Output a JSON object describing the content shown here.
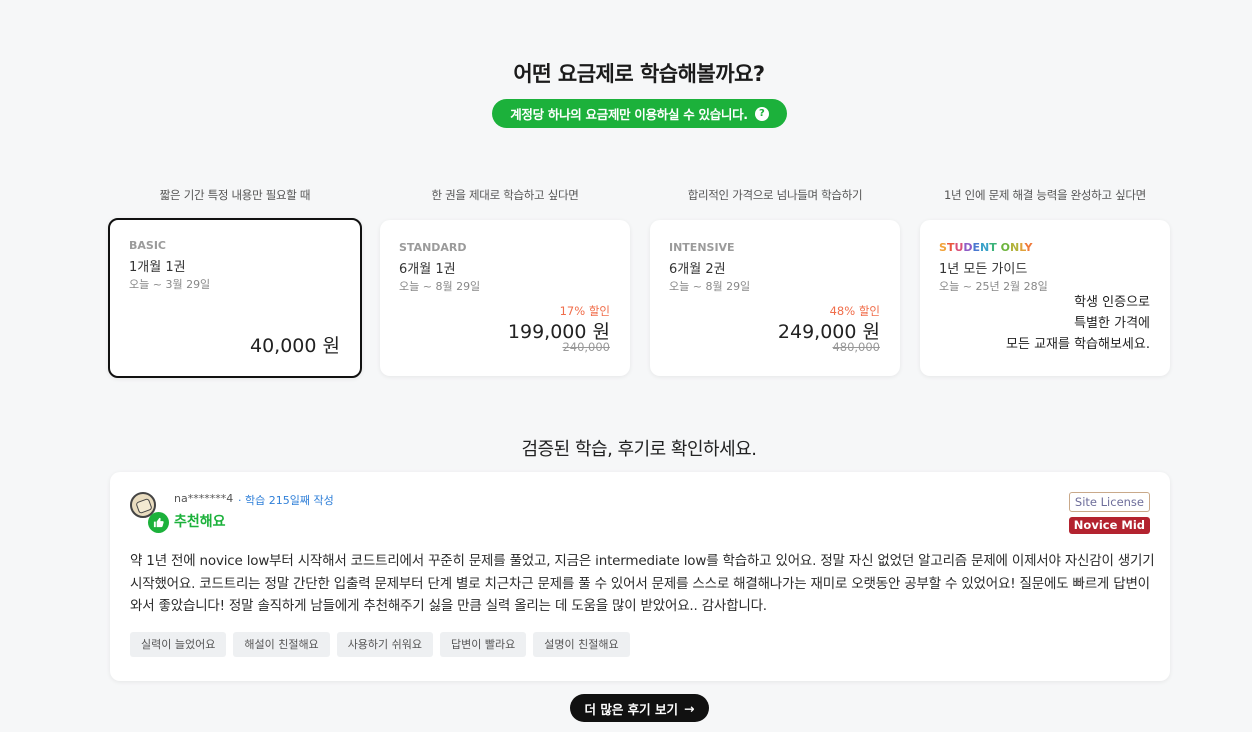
{
  "header": {
    "title": "어떤 요금제로 학습해볼까요?",
    "notice": "계정당 하나의 요금제만 이용하실 수 있습니다.",
    "notice_icon": "question-icon"
  },
  "plans": [
    {
      "caption": "짧은 기간 특정 내용만 필요할 때",
      "name": "BASIC",
      "period": "1개월 1권",
      "range": "오늘 ~ 3월 29일",
      "discount": "",
      "price": "40,000 원",
      "original_price": "",
      "selected": true
    },
    {
      "caption": "한 권을 제대로 학습하고 싶다면",
      "name": "STANDARD",
      "period": "6개월 1권",
      "range": "오늘 ~ 8월 29일",
      "discount": "17% 할인",
      "price": "199,000 원",
      "original_price": "240,000",
      "selected": false
    },
    {
      "caption": "합리적인 가격으로 넘나들며 학습하기",
      "name": "INTENSIVE",
      "period": "6개월 2권",
      "range": "오늘 ~ 8월 29일",
      "discount": "48% 할인",
      "price": "249,000 원",
      "original_price": "480,000",
      "selected": false
    },
    {
      "caption": "1년 인에 문제 해결 능력을 완성하고 싶다면",
      "name": "STUDENT ONLY",
      "period": "1년 모든 가이드",
      "range": "오늘 ~ 25년 2월 28일",
      "description": [
        "학생 인증으로",
        "특별한 가격에",
        "모든 교재를 학습해보세요."
      ],
      "selected": false
    }
  ],
  "reviews": {
    "heading": "검증된 학습, 후기로 확인하세요.",
    "item": {
      "username": "na*******4",
      "study_days": "· 학습 215일째 작성",
      "recommend": "추천해요",
      "badge_license": "Site License",
      "badge_level": "Novice Mid",
      "text": "약 1년 전에 novice low부터 시작해서 코드트리에서 꾸준히 문제를 풀었고, 지금은 intermediate low를 학습하고 있어요. 정말 자신 없었던 알고리즘 문제에 이제서야 자신감이 생기기 시작했어요. 코드트리는 정말 간단한 입출력 문제부터 단계 별로 치근차근 문제를 풀 수 있어서 문제를 스스로 해결해나가는 재미로 오랫동안 공부할 수 있었어요! 질문에도 빠르게 답변이 와서 좋았습니다! 정말 솔직하게 남들에게 추천해주기 싫을 만큼 실력 올리는 데 도움을 많이 받았어요.. 감사합니다.",
      "tags": [
        "실력이 늘었어요",
        "해설이 친절해요",
        "사용하기 쉬워요",
        "답변이 빨라요",
        "설명이 친절해요"
      ]
    },
    "more_button": "더 많은 후기 보기"
  },
  "colors": {
    "accent_green": "#1cb13b",
    "discount_orange": "#f06d4a",
    "level_badge": "#b3232f",
    "link_blue": "#2f7fd8"
  }
}
